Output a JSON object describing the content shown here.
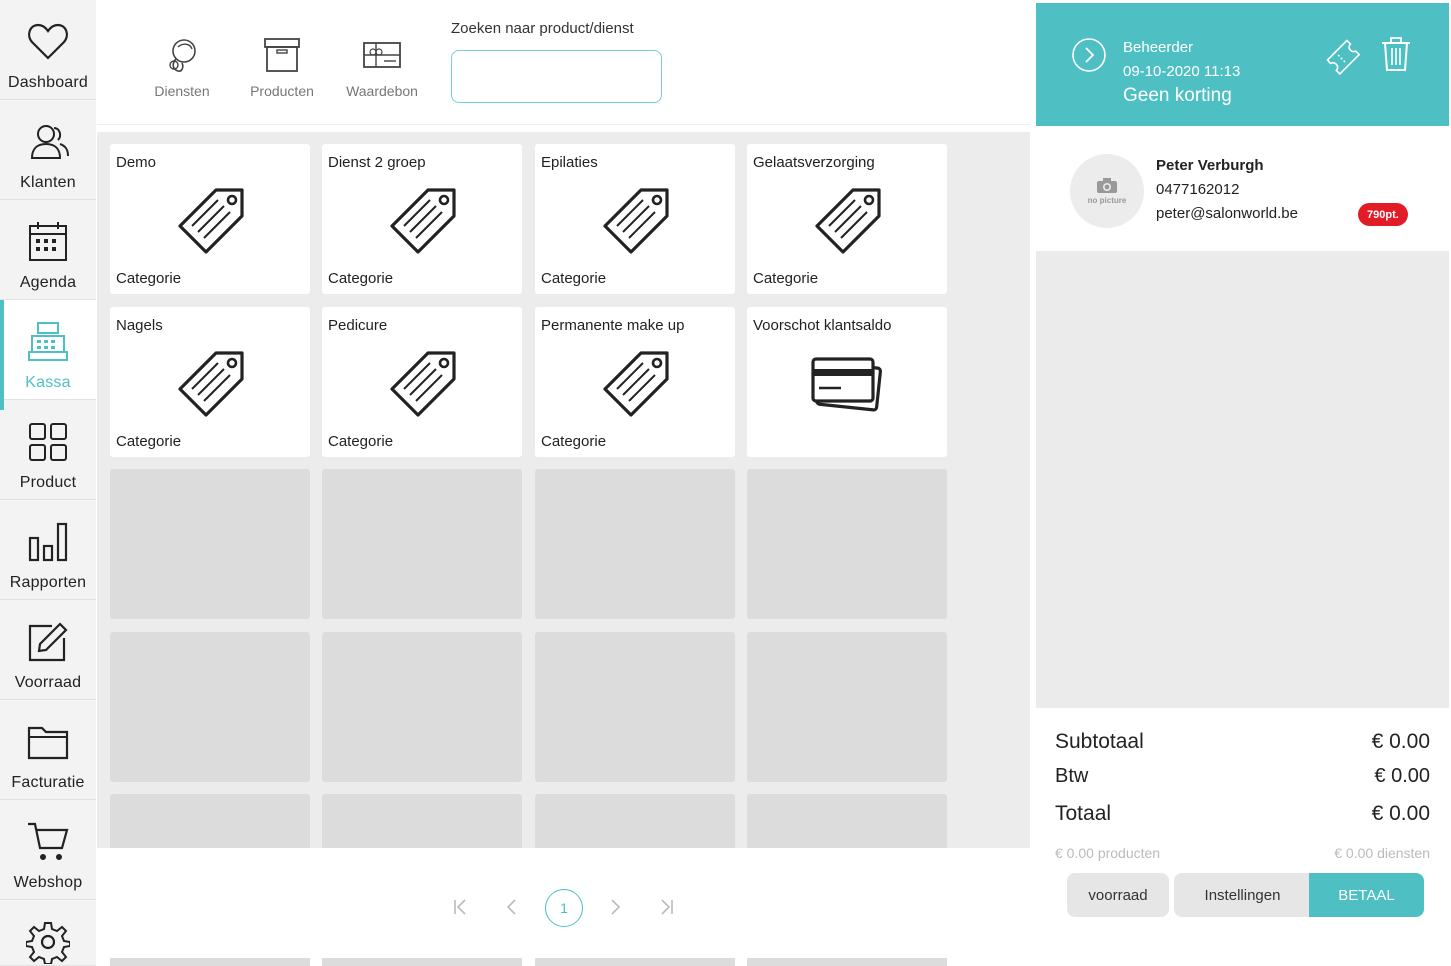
{
  "sidebar": {
    "items": [
      {
        "label": "Dashboard",
        "icon": "heart-icon"
      },
      {
        "label": "Klanten",
        "icon": "users-icon"
      },
      {
        "label": "Agenda",
        "icon": "calendar-icon"
      },
      {
        "label": "Kassa",
        "icon": "cash-register-icon",
        "active": true
      },
      {
        "label": "Product",
        "icon": "grid-icon"
      },
      {
        "label": "Rapporten",
        "icon": "bar-chart-icon"
      },
      {
        "label": "Voorraad",
        "icon": "edit-icon"
      },
      {
        "label": "Facturatie",
        "icon": "folder-icon"
      },
      {
        "label": "Webshop",
        "icon": "cart-icon"
      },
      {
        "label": "",
        "icon": "gear-icon"
      }
    ]
  },
  "toolbar": {
    "diensten_label": "Diensten",
    "producten_label": "Producten",
    "waardebon_label": "Waardebon",
    "search_label": "Zoeken naar product/dienst",
    "search_value": ""
  },
  "tiles": [
    {
      "name": "Demo",
      "category": "Categorie",
      "icon": "tag-icon"
    },
    {
      "name": "Dienst 2 groep",
      "category": "Categorie",
      "icon": "tag-icon"
    },
    {
      "name": "Epilaties",
      "category": "Categorie",
      "icon": "tag-icon"
    },
    {
      "name": "Gelaatsverzorging",
      "category": "Categorie",
      "icon": "tag-icon"
    },
    {
      "name": "Nagels",
      "category": "Categorie",
      "icon": "tag-icon"
    },
    {
      "name": "Pedicure",
      "category": "Categorie",
      "icon": "tag-icon"
    },
    {
      "name": "Permanente make up",
      "category": "Categorie",
      "icon": "tag-icon"
    },
    {
      "name": "Voorschot klantsaldo",
      "category": "",
      "icon": "credit-card-icon"
    }
  ],
  "pagination": {
    "current_page": "1"
  },
  "ticket": {
    "role": "Beheerder",
    "datetime": "09-10-2020 11:13",
    "discount": "Geen korting"
  },
  "customer": {
    "name": "Peter Verburgh",
    "phone": "0477162012",
    "email": "peter@salonworld.be",
    "points": "790pt.",
    "avatar_text": "no picture"
  },
  "totals": {
    "subtotal_label": "Subtotaal",
    "subtotal_value": "€ 0.00",
    "btw_label": "Btw",
    "btw_value": "€ 0.00",
    "total_label": "Totaal",
    "total_value": "€ 0.00",
    "products_summary": "€ 0.00 producten",
    "services_summary": "€ 0.00 diensten"
  },
  "actions": {
    "voorraad_label": "voorraad",
    "instellingen_label": "Instellingen",
    "pay_label": "BETAAL"
  },
  "colors": {
    "accent": "#4ec0c4",
    "points_badge": "#e21c26"
  }
}
